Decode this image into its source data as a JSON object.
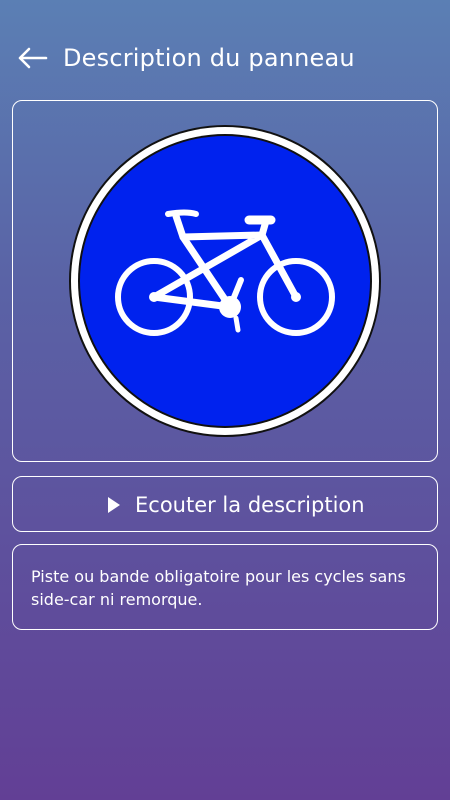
{
  "header": {
    "title": "Description du panneau",
    "back_icon": "arrow-left-icon"
  },
  "sign": {
    "icon": "bicycle-icon",
    "colors": {
      "disc": "#0022ee",
      "border": "#ffffff",
      "outline": "#111111"
    }
  },
  "listen": {
    "label": "Ecouter la description",
    "icon": "play-icon"
  },
  "description": {
    "text": "Piste ou bande obligatoire pour les cycles sans side-car ni remorque."
  },
  "colors": {
    "gradient_top": "#5b7fb4",
    "gradient_bottom": "#623f95",
    "foreground": "#ffffff"
  }
}
